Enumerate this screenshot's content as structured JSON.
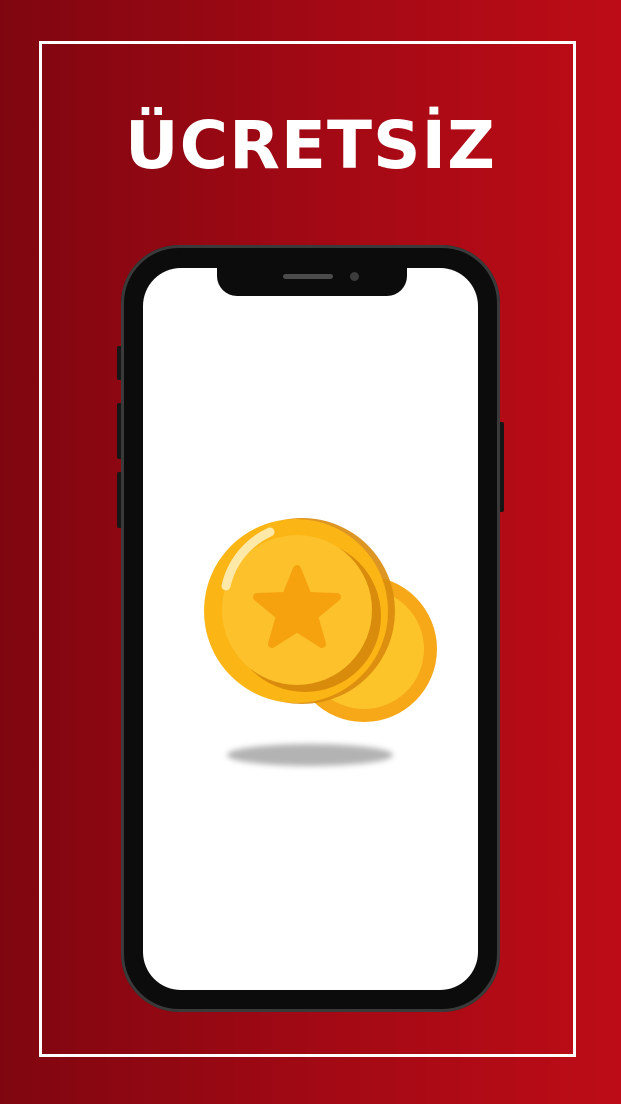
{
  "headline": "ÜCRETSİZ",
  "colors": {
    "background_left": "#7f0610",
    "background_right": "#bd0c17",
    "frame": "#ffffff",
    "phone_body": "#0c0c0c",
    "screen": "#ffffff",
    "coin_gold": "#fdb913",
    "coin_star": "#f5a20e"
  },
  "icons": {
    "main": "gold-coins-star-icon"
  }
}
